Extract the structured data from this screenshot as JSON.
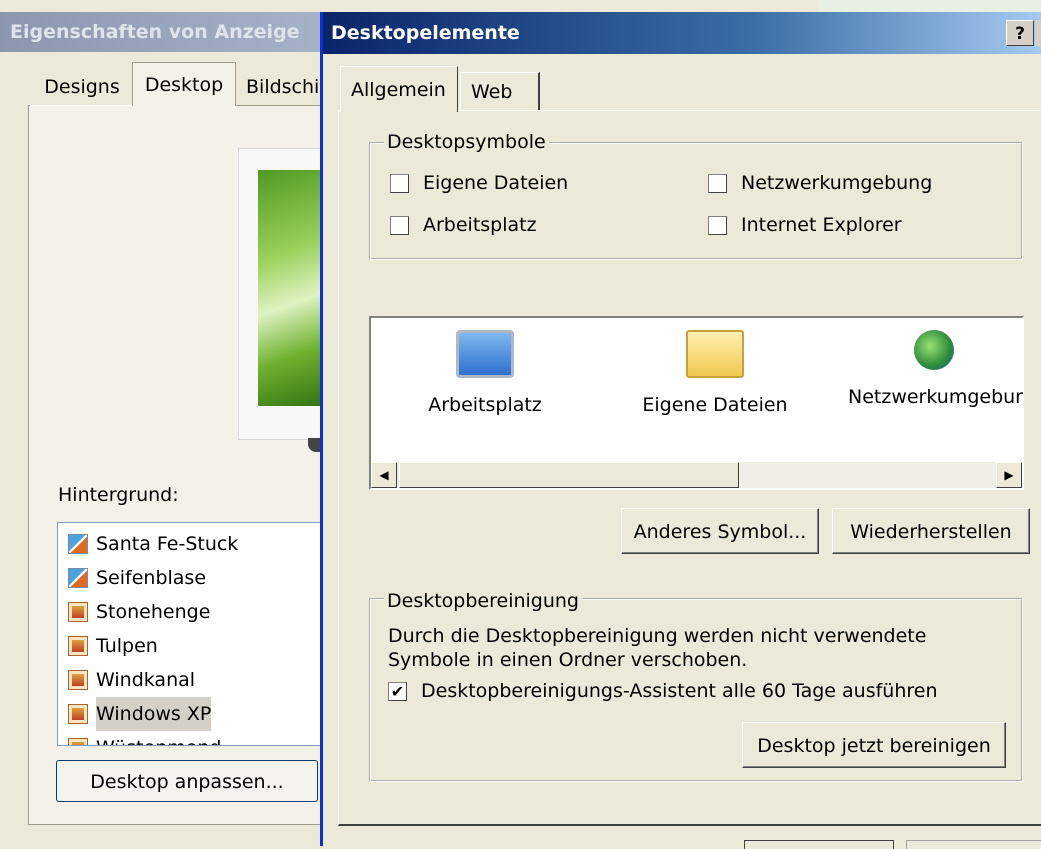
{
  "background_dialog": {
    "title": "Eigenschaften von Anzeige",
    "tabs": [
      {
        "label": "Designs"
      },
      {
        "label": "Desktop"
      },
      {
        "label": "Bildschi"
      }
    ],
    "hintergrund_label": "Hintergrund:",
    "wallpapers": [
      {
        "label": "Santa Fe-Stuck",
        "icon": "paint-icon"
      },
      {
        "label": "Seifenblase",
        "icon": "paint-icon"
      },
      {
        "label": "Stonehenge",
        "icon": "image-icon"
      },
      {
        "label": "Tulpen",
        "icon": "image-icon"
      },
      {
        "label": "Windkanal",
        "icon": "image-icon"
      },
      {
        "label": "Windows XP",
        "icon": "image-icon",
        "selected": true
      },
      {
        "label": "Wüstenmond",
        "icon": "image-icon"
      }
    ],
    "customize_button": "Desktop anpassen..."
  },
  "dialog": {
    "title": "Desktopelemente",
    "help_button": "?",
    "tabs": [
      {
        "label": "Allgemein",
        "active": true
      },
      {
        "label": "Web"
      }
    ],
    "desktop_symbols": {
      "group_title": "Desktopsymbole",
      "checkboxes": [
        {
          "label": "Eigene Dateien",
          "checked": false
        },
        {
          "label": "Arbeitsplatz",
          "checked": false
        },
        {
          "label": "Netzwerkumgebung",
          "checked": false
        },
        {
          "label": "Internet Explorer",
          "checked": false
        }
      ]
    },
    "icon_list": [
      {
        "label": "Arbeitsplatz",
        "icon": "computer-icon"
      },
      {
        "label": "Eigene Dateien",
        "icon": "folder-icon"
      },
      {
        "label": "Netzwerkumgebur",
        "icon": "network-icon"
      }
    ],
    "buttons": {
      "change_icon": "Anderes Symbol...",
      "restore": "Wiederherstellen"
    },
    "cleanup": {
      "group_title": "Desktopbereinigung",
      "description": "Durch die Desktopbereinigung werden nicht verwendete Symbole in einen Ordner verschoben.",
      "assistant_checkbox": {
        "label": "Desktopbereinigungs-Assistent alle 60 Tage ausführen",
        "checked": true
      },
      "clean_now_button": "Desktop jetzt bereinigen"
    }
  },
  "colors": {
    "dialog_bg": "#ece9d8",
    "titlebar_active": "#0a246a",
    "titlebar_inactive": "#8c97ad"
  }
}
